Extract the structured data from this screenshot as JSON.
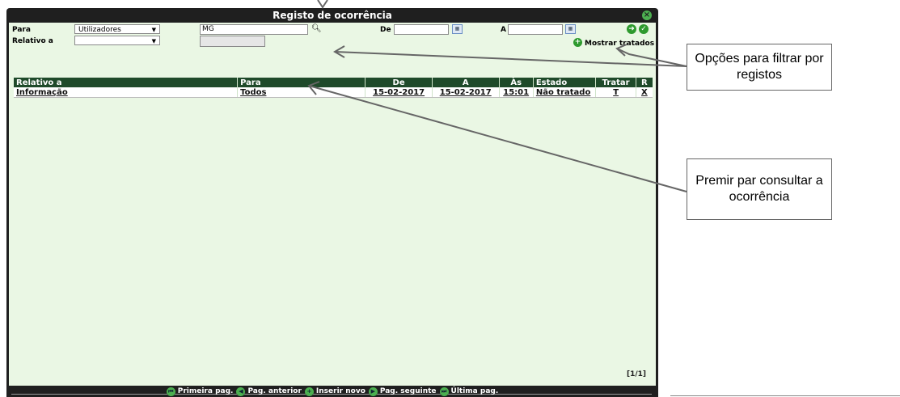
{
  "window": {
    "title": "Registo de ocorrência"
  },
  "filters": {
    "para_label": "Para",
    "para_value": "Utilizadores",
    "relativo_label": "Relativo a",
    "relativo_value": "",
    "search_value": "MG",
    "de_label": "De",
    "de_value": "",
    "a_label": "A",
    "a_value": "",
    "mostrar_tratados": "Mostrar tratados"
  },
  "table": {
    "headers": [
      "Relativo a",
      "Para",
      "De",
      "A",
      "Às",
      "Estado",
      "Tratar",
      "R"
    ],
    "rows": [
      [
        "Informação",
        "Todos",
        "15-02-2017",
        "15-02-2017",
        "15:01",
        "Não tratado",
        "T",
        "X"
      ]
    ]
  },
  "pagination": {
    "count": "[1/1]",
    "first": "Primeira pag.",
    "prev": "Pag. anterior",
    "insert": "Inserir novo",
    "next": "Pag. seguinte",
    "last": "Última pag."
  },
  "callouts": {
    "filter": "Opções para filtrar por registos",
    "consult": "Premir par consultar a ocorrência"
  },
  "icons": [
    "close-icon",
    "search-icon",
    "calendar-icon",
    "arrow-right-icon",
    "check-icon",
    "plus-icon",
    "first-page-icon",
    "prev-page-icon",
    "next-page-icon",
    "last-page-icon"
  ],
  "colors": {
    "frame": "#1f1f1f",
    "panel": "#eaf7e4",
    "header": "#1f4a2a",
    "accent": "#2e9a2e"
  }
}
